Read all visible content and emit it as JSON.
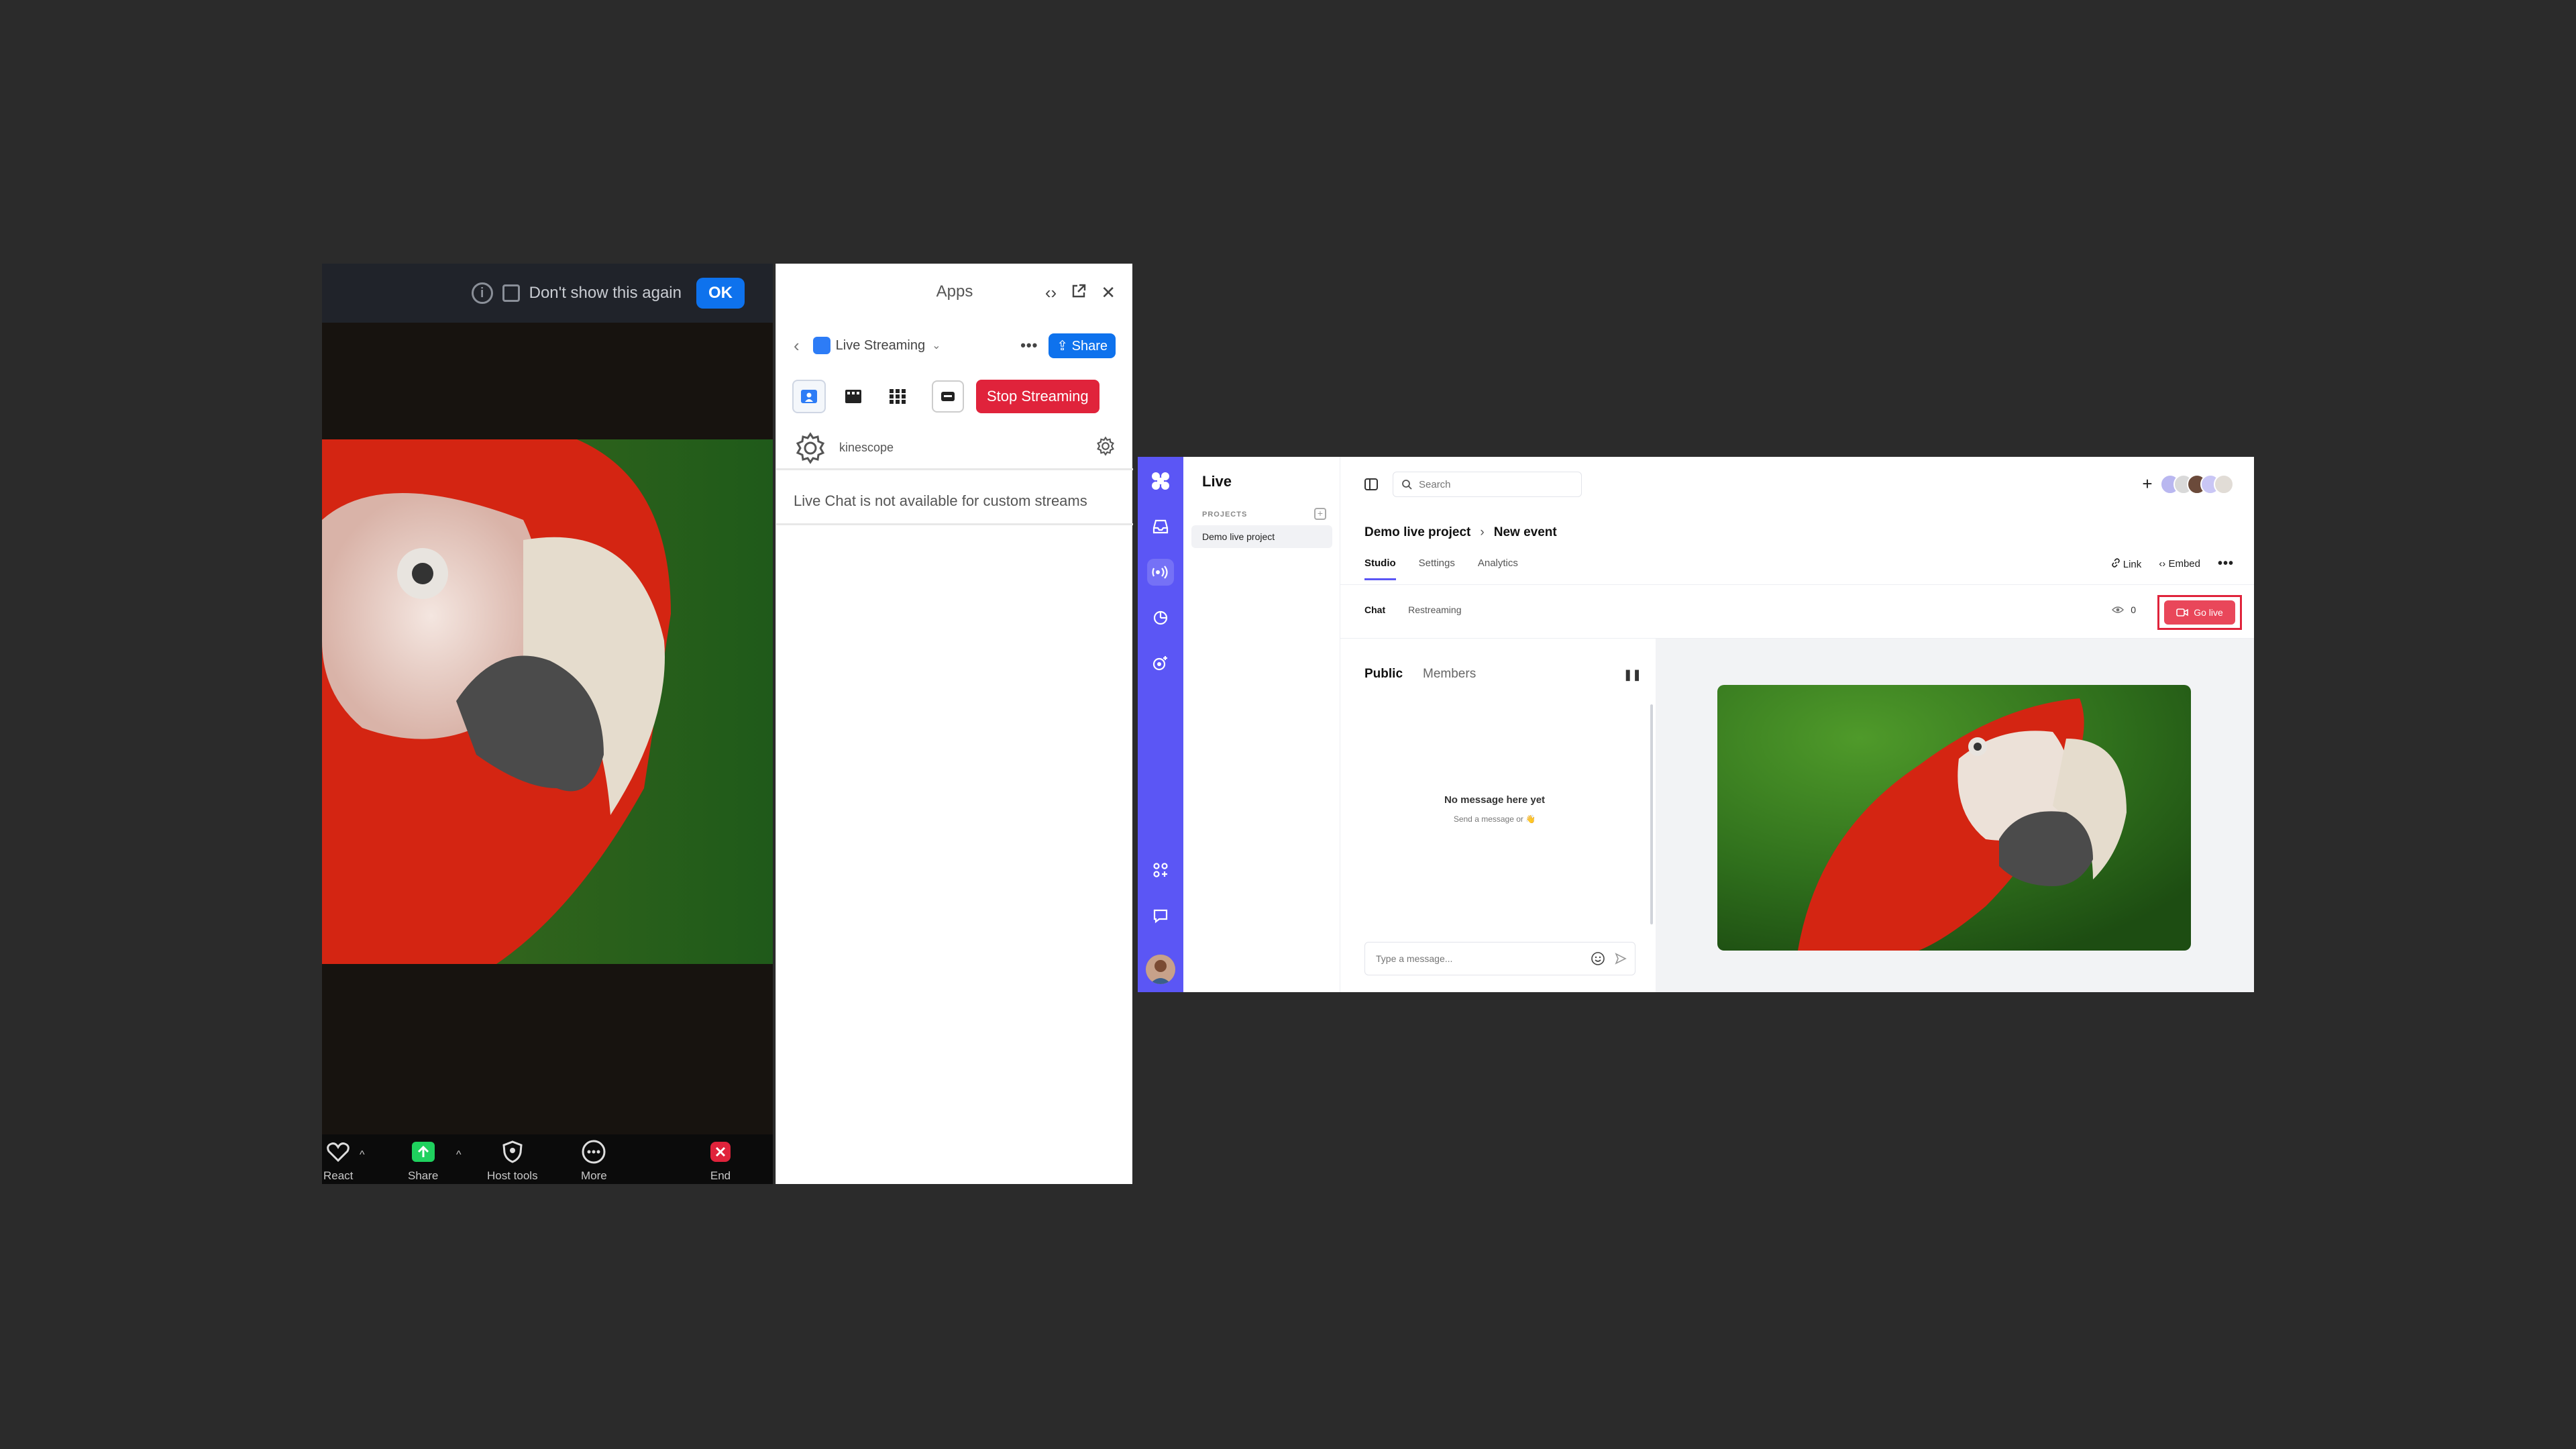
{
  "zoom": {
    "banner": {
      "dont_show_label": "Don't show this again",
      "ok_label": "OK"
    },
    "toolbar": {
      "react_label": "React",
      "share_label": "Share",
      "host_tools_label": "Host tools",
      "more_label": "More",
      "end_label": "End"
    }
  },
  "apps_panel": {
    "title": "Apps",
    "app_name": "Live Streaming",
    "share_label": "Share",
    "stop_streaming_label": "Stop Streaming",
    "stream_target": "kinescope",
    "chat_unavailable": "Live Chat is not available for custom streams"
  },
  "kinescope": {
    "section_title": "Live",
    "projects_heading": "PROJECTS",
    "projects": [
      "Demo live project"
    ],
    "search": {
      "placeholder": "Search"
    },
    "breadcrumb": {
      "project": "Demo live project",
      "event": "New event"
    },
    "tabs": [
      "Studio",
      "Settings",
      "Analytics"
    ],
    "active_tab": "Studio",
    "actions": {
      "link": "Link",
      "embed": "Embed"
    },
    "subtabs": [
      "Chat",
      "Restreaming"
    ],
    "viewers_count": "0",
    "go_live_label": "Go live",
    "chat": {
      "tabs": [
        "Public",
        "Members"
      ],
      "empty_title": "No message here yet",
      "empty_subtitle": "Send a message or 👋",
      "input_placeholder": "Type a message..."
    },
    "accent_color": "#5b56f5",
    "go_live_color": "#e9475a"
  }
}
